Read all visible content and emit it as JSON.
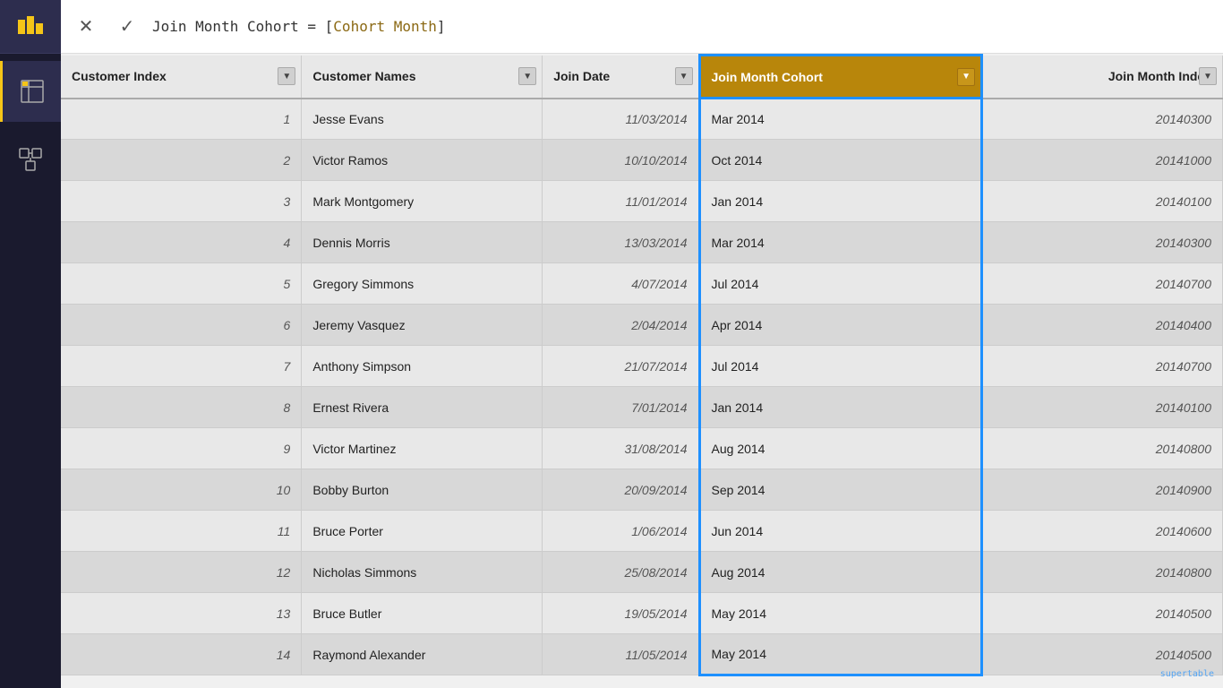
{
  "sidebar": {
    "icon_chart": "▮",
    "icon_table": "⊞",
    "icon_model": "⧉"
  },
  "formula_bar": {
    "cancel_label": "✕",
    "accept_label": "✓",
    "formula_prefix": "Join Month Cohort = [",
    "formula_highlight": "Cohort Month",
    "formula_suffix": "]"
  },
  "columns": [
    {
      "id": "customer_index",
      "label": "Customer Index",
      "type": "index"
    },
    {
      "id": "customer_names",
      "label": "Customer Names",
      "type": "name"
    },
    {
      "id": "join_date",
      "label": "Join Date",
      "type": "date"
    },
    {
      "id": "join_month_cohort",
      "label": "Join Month Cohort",
      "type": "cohort"
    },
    {
      "id": "join_month_index",
      "label": "Join Month Index",
      "type": "join_index"
    }
  ],
  "rows": [
    {
      "index": 1,
      "name": "Jesse Evans",
      "date": "11/03/2014",
      "cohort": "Mar 2014",
      "join_index": "20140300"
    },
    {
      "index": 2,
      "name": "Victor Ramos",
      "date": "10/10/2014",
      "cohort": "Oct 2014",
      "join_index": "20141000"
    },
    {
      "index": 3,
      "name": "Mark Montgomery",
      "date": "11/01/2014",
      "cohort": "Jan 2014",
      "join_index": "20140100"
    },
    {
      "index": 4,
      "name": "Dennis Morris",
      "date": "13/03/2014",
      "cohort": "Mar 2014",
      "join_index": "20140300"
    },
    {
      "index": 5,
      "name": "Gregory Simmons",
      "date": "4/07/2014",
      "cohort": "Jul 2014",
      "join_index": "20140700"
    },
    {
      "index": 6,
      "name": "Jeremy Vasquez",
      "date": "2/04/2014",
      "cohort": "Apr 2014",
      "join_index": "20140400"
    },
    {
      "index": 7,
      "name": "Anthony Simpson",
      "date": "21/07/2014",
      "cohort": "Jul 2014",
      "join_index": "20140700"
    },
    {
      "index": 8,
      "name": "Ernest Rivera",
      "date": "7/01/2014",
      "cohort": "Jan 2014",
      "join_index": "20140100"
    },
    {
      "index": 9,
      "name": "Victor Martinez",
      "date": "31/08/2014",
      "cohort": "Aug 2014",
      "join_index": "20140800"
    },
    {
      "index": 10,
      "name": "Bobby Burton",
      "date": "20/09/2014",
      "cohort": "Sep 2014",
      "join_index": "20140900"
    },
    {
      "index": 11,
      "name": "Bruce Porter",
      "date": "1/06/2014",
      "cohort": "Jun 2014",
      "join_index": "20140600"
    },
    {
      "index": 12,
      "name": "Nicholas Simmons",
      "date": "25/08/2014",
      "cohort": "Aug 2014",
      "join_index": "20140800"
    },
    {
      "index": 13,
      "name": "Bruce Butler",
      "date": "19/05/2014",
      "cohort": "May 2014",
      "join_index": "20140500"
    },
    {
      "index": 14,
      "name": "Raymond Alexander",
      "date": "11/05/2014",
      "cohort": "May 2014",
      "join_index": "20140500"
    }
  ],
  "watermark": "supertable"
}
